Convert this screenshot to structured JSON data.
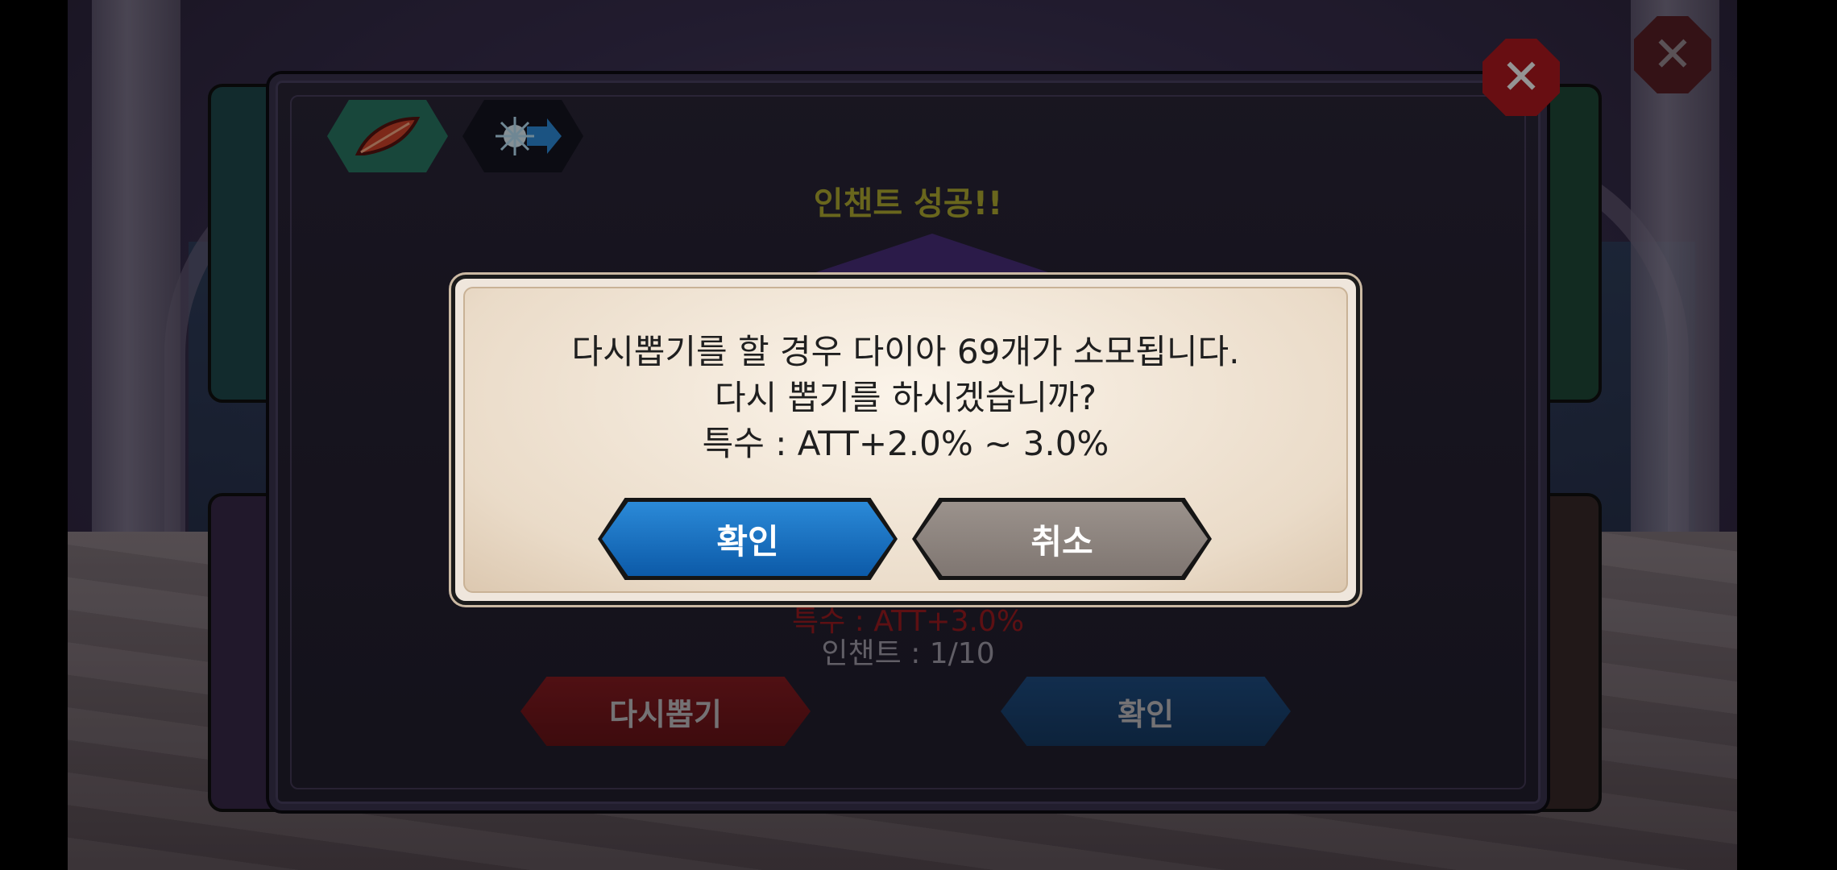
{
  "panel": {
    "title": "인챈트 성공!!",
    "special_result": "특수 : ATT+3.0%",
    "enchant_status": "인챈트 : 1/10",
    "reroll_label": "다시뽑기",
    "confirm_label": "확인"
  },
  "dialog": {
    "line1": "다시뽑기를 할 경우 다이아 69개가 소모됩니다.",
    "line2": "다시 뽑기를 하시겠습니까?",
    "line3": "특수 : ATT+2.0% ~ 3.0%",
    "ok_label": "확인",
    "cancel_label": "취소"
  },
  "colors": {
    "title_yellow": "#b6b033",
    "special_red": "#a11c22",
    "ok_blue": "#0c5aa8",
    "cancel_gray": "#7f7671",
    "close_red": "#b3191f"
  },
  "icons": {
    "feather": "feather-icon",
    "light_arrow": "light-arrow-icon",
    "close": "close-icon"
  }
}
